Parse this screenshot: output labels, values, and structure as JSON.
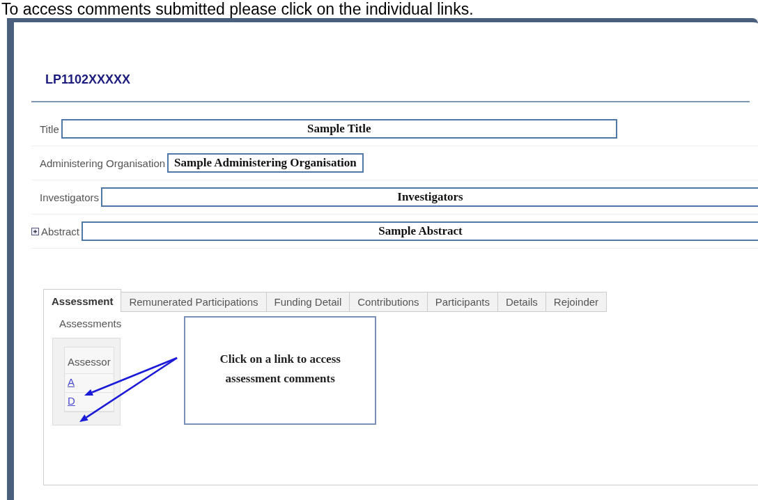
{
  "instruction": "To access comments submitted please click on the individual links.",
  "grant": {
    "code": "LP1102XXXXX"
  },
  "fields": [
    {
      "label": "Title",
      "value": "Sample Title",
      "kind": "short"
    },
    {
      "label": "Administering Organisation",
      "value": "Sample Administering Organisation",
      "kind": "fit"
    },
    {
      "label": "Investigators",
      "value": "Investigators",
      "kind": "wide"
    },
    {
      "label": "Abstract",
      "value": "Sample Abstract",
      "kind": "wide",
      "expandable": true
    }
  ],
  "tabs": [
    {
      "label": "Assessment",
      "selected": true
    },
    {
      "label": "Remunerated Participations",
      "selected": false
    },
    {
      "label": "Funding Detail",
      "selected": false
    },
    {
      "label": "Contributions",
      "selected": false
    },
    {
      "label": "Participants",
      "selected": false
    },
    {
      "label": "Details",
      "selected": false
    },
    {
      "label": "Rejoinder",
      "selected": false
    }
  ],
  "assessments": {
    "heading": "Assessments",
    "column": "Assessor",
    "links": [
      "A",
      "D"
    ]
  },
  "callout": {
    "lines": [
      "Click on a link to access",
      "assessment comments"
    ]
  }
}
